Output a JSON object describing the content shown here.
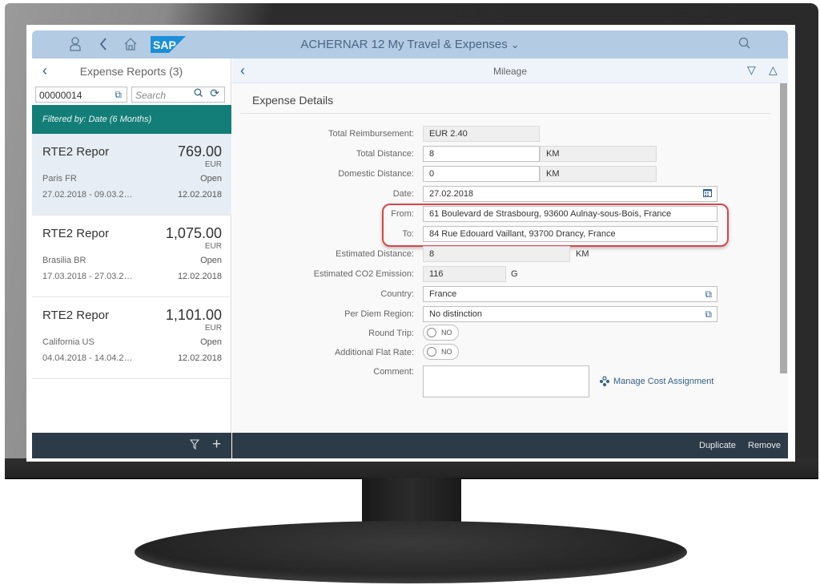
{
  "shell": {
    "title": "ACHERNAR 12 My Travel & Expenses",
    "logo_text": "SAP",
    "icons": [
      "user-icon",
      "back-icon",
      "home-icon",
      "search-icon"
    ]
  },
  "master": {
    "title": "Expense Reports (3)",
    "id_value": "00000014",
    "search_placeholder": "Search",
    "filter_text": "Filtered by: Date (6 Months)",
    "items": [
      {
        "name": "RTE2 Repor",
        "amount": "769.00",
        "currency": "EUR",
        "location": "Paris FR",
        "status": "Open",
        "dates": "27.02.2018 - 09.03.2…",
        "report_date": "12.02.2018",
        "selected": true
      },
      {
        "name": "RTE2 Repor",
        "amount": "1,075.00",
        "currency": "EUR",
        "location": "Brasilia BR",
        "status": "Open",
        "dates": "17.03.2018 - 27.03.2…",
        "report_date": "12.02.2018",
        "selected": false
      },
      {
        "name": "RTE2 Repor",
        "amount": "1,101.00",
        "currency": "EUR",
        "location": "California US",
        "status": "Open",
        "dates": "04.04.2018 - 14.04.2…",
        "report_date": "12.02.2018",
        "selected": false
      }
    ]
  },
  "detail": {
    "title": "Mileage",
    "section_title": "Expense Details",
    "fields": {
      "total_reimbursement": {
        "label": "Total Reimbursement:",
        "value": "EUR 2.40"
      },
      "total_distance": {
        "label": "Total Distance:",
        "value": "8",
        "unit": "KM"
      },
      "domestic_distance": {
        "label": "Domestic Distance:",
        "value": "0",
        "unit": "KM"
      },
      "date": {
        "label": "Date:",
        "value": "27.02.2018"
      },
      "from": {
        "label": "From:",
        "value": "61 Boulevard de Strasbourg, 93600 Aulnay-sous-Bois, France"
      },
      "to": {
        "label": "To:",
        "value": "84 Rue Edouard Vaillant, 93700 Drancy, France"
      },
      "estimated_distance": {
        "label": "Estimated Distance:",
        "value": "8",
        "unit": "KM"
      },
      "co2": {
        "label": "Estimated CO2 Emission:",
        "value": "116",
        "unit": "G"
      },
      "country": {
        "label": "Country:",
        "value": "France"
      },
      "per_diem": {
        "label": "Per Diem Region:",
        "value": "No distinction"
      },
      "round_trip": {
        "label": "Round Trip:",
        "value": "NO"
      },
      "flat_rate": {
        "label": "Additional Flat Rate:",
        "value": "NO"
      },
      "comment": {
        "label": "Comment:",
        "value": ""
      }
    },
    "manage_cost_link": "Manage Cost Assignment",
    "highlight_color": "#d9454a"
  },
  "footer": {
    "duplicate": "Duplicate",
    "remove": "Remove"
  },
  "colors": {
    "shell_bg": "#b3cbe3",
    "filter_bg": "#137e78",
    "footer_bg": "#2d3b48",
    "link": "#346187"
  }
}
